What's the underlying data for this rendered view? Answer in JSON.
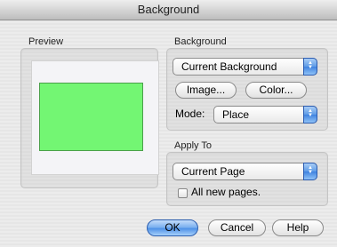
{
  "window": {
    "title": "Background"
  },
  "preview": {
    "label": "Preview",
    "fill_color": "#73f673"
  },
  "background_section": {
    "label": "Background",
    "source_popup": "Current Background",
    "image_button": "Image...",
    "color_button": "Color...",
    "mode_label": "Mode:",
    "mode_popup": "Place"
  },
  "apply_section": {
    "label": "Apply To",
    "target_popup": "Current Page",
    "all_new_pages_label": "All new pages.",
    "all_new_pages_checked": false
  },
  "buttons": {
    "ok": "OK",
    "cancel": "Cancel",
    "help": "Help"
  }
}
